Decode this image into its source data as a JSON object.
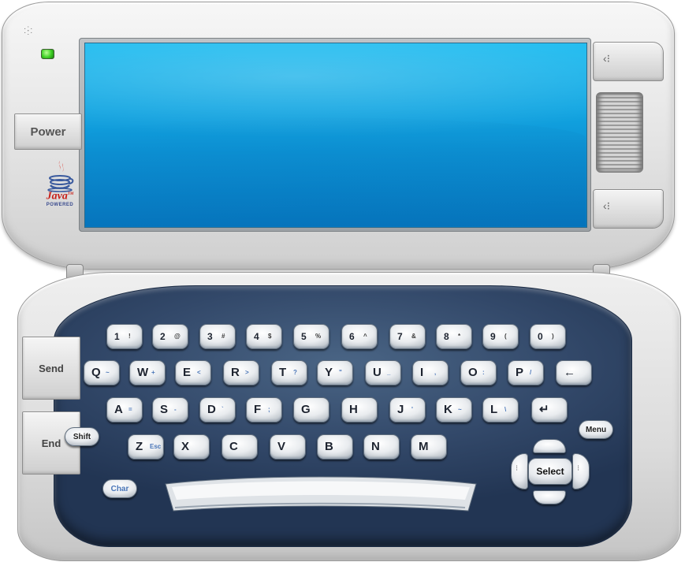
{
  "device": {
    "speaker_icon": "speaker-grille-icon",
    "led_color": "#3ccd23",
    "screen_color": "#12a6e2",
    "deck_color": "#33496a"
  },
  "lid": {
    "power_label": "Power",
    "java_logo": {
      "word": "Java",
      "tm": "TM",
      "sub": "POWERED"
    },
    "nav_up_icon": "dotted-chevron-left-icon",
    "nav_down_icon": "dotted-chevron-left-icon"
  },
  "side_buttons": {
    "send": "Send",
    "end": "End"
  },
  "keyboard": {
    "rows": [
      [
        {
          "main": "1",
          "sub": "!"
        },
        {
          "main": "2",
          "sub": "@"
        },
        {
          "main": "3",
          "sub": "#"
        },
        {
          "main": "4",
          "sub": "$"
        },
        {
          "main": "5",
          "sub": "%"
        },
        {
          "main": "6",
          "sub": "^"
        },
        {
          "main": "7",
          "sub": "&"
        },
        {
          "main": "8",
          "sub": "*"
        },
        {
          "main": "9",
          "sub": "("
        },
        {
          "main": "0",
          "sub": ")"
        }
      ],
      [
        {
          "main": "Q",
          "sub": "~"
        },
        {
          "main": "W",
          "sub": "+"
        },
        {
          "main": "E",
          "sub": "<"
        },
        {
          "main": "R",
          "sub": ">"
        },
        {
          "main": "T",
          "sub": "?"
        },
        {
          "main": "Y",
          "sub": "\""
        },
        {
          "main": "U",
          "sub": "_"
        },
        {
          "main": "I",
          "sub": ","
        },
        {
          "main": "O",
          "sub": ":"
        },
        {
          "main": "P",
          "sub": "/"
        },
        {
          "main": "←",
          "sub": ""
        }
      ],
      [
        {
          "main": "A",
          "sub": "="
        },
        {
          "main": "S",
          "sub": "-"
        },
        {
          "main": "D",
          "sub": "`"
        },
        {
          "main": "F",
          "sub": ";"
        },
        {
          "main": "G",
          "sub": ""
        },
        {
          "main": "H",
          "sub": ""
        },
        {
          "main": "J",
          "sub": "'"
        },
        {
          "main": "K",
          "sub": "~"
        },
        {
          "main": "L",
          "sub": "\\"
        },
        {
          "main": "↵",
          "sub": ""
        }
      ],
      [
        {
          "main": "Z",
          "sub": "Esc"
        },
        {
          "main": "X",
          "sub": ""
        },
        {
          "main": "C",
          "sub": ""
        },
        {
          "main": "V",
          "sub": ""
        },
        {
          "main": "B",
          "sub": ""
        },
        {
          "main": "N",
          "sub": ""
        },
        {
          "main": "M",
          "sub": ""
        }
      ]
    ],
    "shift_label": "Shift",
    "char_label": "Char",
    "menu_label": "Menu",
    "select_label": "Select"
  }
}
